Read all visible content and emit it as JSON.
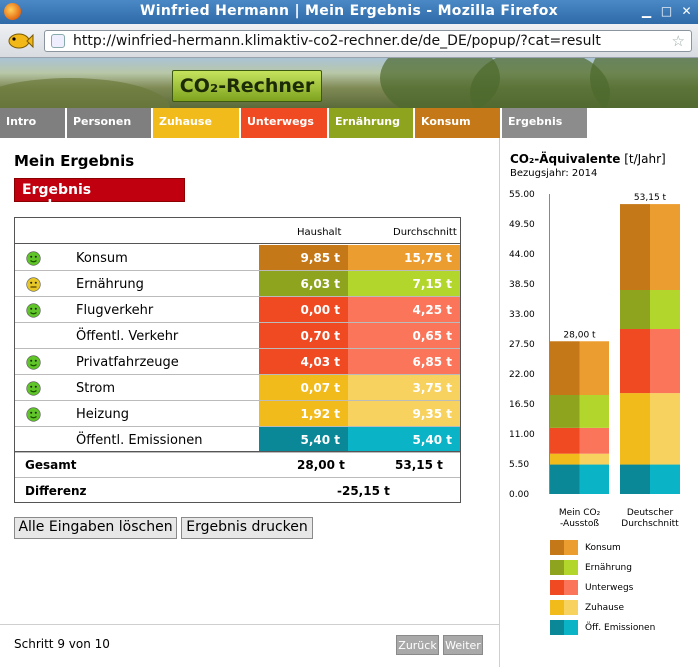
{
  "window": {
    "title": "Winfried Hermann | Mein Ergebnis - Mozilla Firefox",
    "url": "http://winfried-hermann.klimaktiv-co2-rechner.de/de_DE/popup/?cat=result"
  },
  "banner": {
    "logo": "CO₂-Rechner"
  },
  "tabs": [
    {
      "label": "Intro",
      "color": "#7f7f7f"
    },
    {
      "label": "Personen",
      "color": "#7f7f7f"
    },
    {
      "label": "Zuhause",
      "color": "#f2bb1c"
    },
    {
      "label": "Unterwegs",
      "color": "#f04a23"
    },
    {
      "label": "Ernährung",
      "color": "#8fa41e"
    },
    {
      "label": "Konsum",
      "color": "#c57817"
    },
    {
      "label": "Ergebnis",
      "color": "#8c8c8c"
    }
  ],
  "main": {
    "title": "Mein Ergebnis",
    "improve_label": "Ergebnis verbessern",
    "table": {
      "col_household": "Haushalt",
      "col_average": "Durchschnitt",
      "rows": [
        {
          "category": "Konsum",
          "smiley": "happy",
          "household": "9,85 t",
          "average": "15,75 t",
          "color_h": "#c57817",
          "color_d": "#ec9d30"
        },
        {
          "category": "Ernährung",
          "smiley": "neutral",
          "household": "6,03 t",
          "average": "7,15 t",
          "color_h": "#8fa41e",
          "color_d": "#b3d62d"
        },
        {
          "category": "Flugverkehr",
          "smiley": "happy",
          "household": "0,00 t",
          "average": "4,25 t",
          "color_h": "#f04a23",
          "color_d": "#fa755a"
        },
        {
          "category": "Öffentl. Verkehr",
          "smiley": "",
          "household": "0,70 t",
          "average": "0,65 t",
          "color_h": "#f04a23",
          "color_d": "#fa755a"
        },
        {
          "category": "Privatfahrzeuge",
          "smiley": "happy",
          "household": "4,03 t",
          "average": "6,85 t",
          "color_h": "#f04a23",
          "color_d": "#fa755a"
        },
        {
          "category": "Strom",
          "smiley": "happy",
          "household": "0,07 t",
          "average": "3,75 t",
          "color_h": "#f2bb1c",
          "color_d": "#f7d25f"
        },
        {
          "category": "Heizung",
          "smiley": "happy",
          "household": "1,92 t",
          "average": "9,35 t",
          "color_h": "#f2bb1c",
          "color_d": "#f7d25f"
        },
        {
          "category": "Öffentl. Emissionen",
          "smiley": "",
          "household": "5,40 t",
          "average": "5,40 t",
          "color_h": "#0a8898",
          "color_d": "#0bb3c6"
        }
      ],
      "total_label": "Gesamt",
      "total_household": "28,00 t",
      "total_average": "53,15 t",
      "diff_label": "Differenz",
      "diff_value": "-25,15 t"
    },
    "clear_label": "Alle Eingaben löschen",
    "print_label": "Ergebnis drucken",
    "step_text": "Schritt 9 von 10",
    "back_label": "Zurück",
    "next_label": "Weiter"
  },
  "side": {
    "title_bold": "CO₂-Äquivalente",
    "title_unit": " [t/Jahr]",
    "ref_year": "Bezugsjahr: 2014"
  },
  "chart_data": {
    "type": "bar",
    "stacked": true,
    "categories": [
      "Mein CO₂ -Ausstoß",
      "Deutscher Durchschnitt"
    ],
    "y_ticks": [
      "0.00",
      "5.50",
      "11.00",
      "16.50",
      "22.00",
      "27.50",
      "33.00",
      "38.50",
      "44.00",
      "49.50",
      "55.00"
    ],
    "ylim": [
      0,
      55
    ],
    "totals": [
      "28,00 t",
      "53,15 t"
    ],
    "series": [
      {
        "name": "Öff. Emissionen",
        "values": [
          5.4,
          5.4
        ],
        "colors": [
          "#0a8898",
          "#0bb3c6"
        ]
      },
      {
        "name": "Zuhause",
        "values": [
          1.99,
          13.1
        ],
        "colors": [
          "#f2bb1c",
          "#f7d25f"
        ]
      },
      {
        "name": "Unterwegs",
        "values": [
          4.73,
          11.75
        ],
        "colors": [
          "#f04a23",
          "#fa755a"
        ]
      },
      {
        "name": "Ernährung",
        "values": [
          6.03,
          7.15
        ],
        "colors": [
          "#8fa41e",
          "#b3d62d"
        ]
      },
      {
        "name": "Konsum",
        "values": [
          9.85,
          15.75
        ],
        "colors": [
          "#c57817",
          "#ec9d30"
        ]
      }
    ],
    "legend_order": [
      "Konsum",
      "Ernährung",
      "Unterwegs",
      "Zuhause",
      "Öff. Emissionen"
    ]
  }
}
